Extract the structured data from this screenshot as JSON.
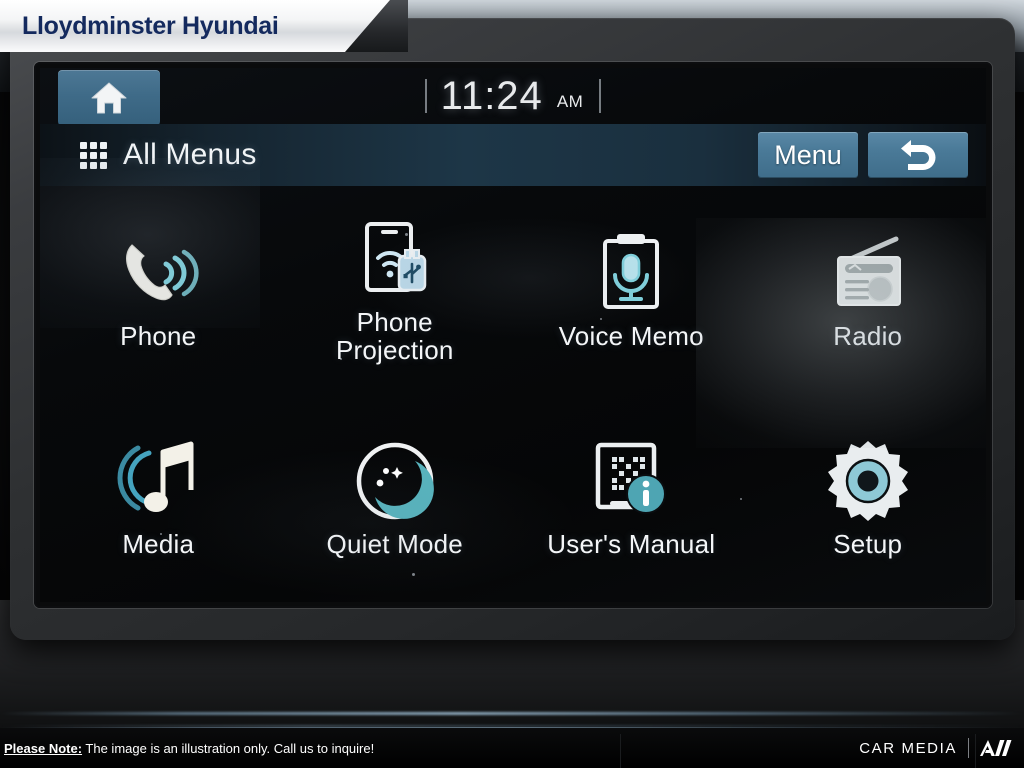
{
  "banner": {
    "dealer_name": "Lloydminster Hyundai"
  },
  "head_unit": {
    "status_bar": {
      "home_icon": "home-icon",
      "clock": {
        "time": "11:24",
        "period": "AM"
      }
    },
    "title_bar": {
      "grid_icon": "grid-menu-icon",
      "title": "All Menus",
      "menu_label": "Menu",
      "back_icon": "back-arrow-icon"
    },
    "apps": [
      {
        "id": "phone",
        "label": "Phone",
        "icon": "phone-handset-icon",
        "dimmed": false
      },
      {
        "id": "phone-projection",
        "label": "Phone\nProjection",
        "icon": "phone-projection-icon",
        "dimmed": false
      },
      {
        "id": "voice-memo",
        "label": "Voice Memo",
        "icon": "voice-memo-icon",
        "dimmed": false
      },
      {
        "id": "radio",
        "label": "Radio",
        "icon": "radio-icon",
        "dimmed": true
      },
      {
        "id": "media",
        "label": "Media",
        "icon": "music-note-icon",
        "dimmed": false
      },
      {
        "id": "quiet-mode",
        "label": "Quiet Mode",
        "icon": "moon-icon",
        "dimmed": false
      },
      {
        "id": "users-manual",
        "label": "User's Manual",
        "icon": "qr-manual-icon",
        "dimmed": false
      },
      {
        "id": "setup",
        "label": "Setup",
        "icon": "gear-icon",
        "dimmed": false
      }
    ]
  },
  "footer": {
    "note_label": "Please Note:",
    "note_text": " The image is an illustration only. Call us to inquire!",
    "brand_text": "CAR MEDIA",
    "brand_mark": "A//"
  },
  "colors": {
    "banner_text": "#142a5e",
    "accent_blue": "#4a7a98",
    "title_bar_blue": "#1d3647",
    "icon_cyan": "#6fc9d6",
    "icon_white": "#f2f2ee",
    "screen_black": "#07090b"
  }
}
